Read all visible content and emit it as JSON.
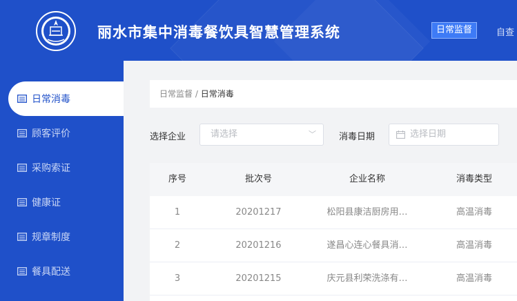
{
  "header": {
    "app_title": "丽水市集中消毒餐饮具智慧管理系统",
    "nav_active": "日常监督",
    "nav_next": "自查"
  },
  "sidebar": {
    "items": [
      {
        "label": "日常消毒",
        "active": true
      },
      {
        "label": "顾客评价",
        "active": false
      },
      {
        "label": "采购索证",
        "active": false
      },
      {
        "label": "健康证",
        "active": false
      },
      {
        "label": "规章制度",
        "active": false
      },
      {
        "label": "餐具配送",
        "active": false
      }
    ]
  },
  "breadcrumb": {
    "parent": "日常监督",
    "separator": "/",
    "current": "日常消毒"
  },
  "filters": {
    "company_label": "选择企业",
    "company_placeholder": "请选择",
    "date_label": "消毒日期",
    "date_placeholder": "选择日期"
  },
  "table": {
    "columns": [
      "序号",
      "批次号",
      "企业名称",
      "消毒类型"
    ],
    "rows": [
      [
        "1",
        "20201217",
        "松阳县康洁厨房用…",
        "高温消毒"
      ],
      [
        "2",
        "20201216",
        "遂昌心连心餐具消…",
        "高温消毒"
      ],
      [
        "3",
        "20201215",
        "庆元县利荣洗涤有…",
        "高温消毒"
      ]
    ]
  },
  "colors": {
    "brand": "#1f50c9",
    "active_tab": "#3e7bf6",
    "page_bg": "#f2f3f5"
  }
}
